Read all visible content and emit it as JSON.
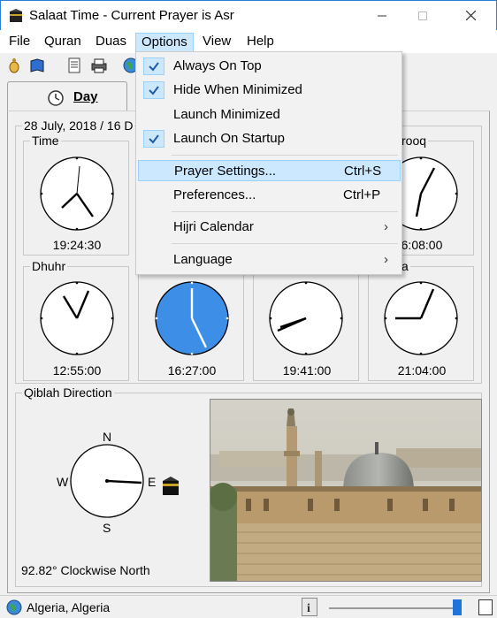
{
  "window": {
    "title": "Salaat Time - Current Prayer is Asr",
    "icon": "kaaba-icon"
  },
  "menubar": {
    "items": [
      "File",
      "Quran",
      "Duas",
      "Options",
      "View",
      "Help"
    ],
    "active": "Options"
  },
  "tabs": {
    "day_label": "Day"
  },
  "date_line": "28 July, 2018 / 16 D",
  "clocks": [
    {
      "label": "Time",
      "time": "19:24:30"
    },
    {
      "label": "rooq",
      "time": "6:08:00"
    },
    {
      "label": "Dhuhr",
      "time": "12:55:00"
    },
    {
      "label": "",
      "time": "16:27:00",
      "current": true
    },
    {
      "label": "",
      "time": "19:41:00"
    },
    {
      "label": "a",
      "time": "21:04:00"
    }
  ],
  "qiblah": {
    "title": "Qiblah Direction",
    "n": "N",
    "s": "S",
    "e": "E",
    "w": "W",
    "bearing": "92.82° Clockwise North"
  },
  "options_menu": {
    "always_on_top": {
      "label": "Always On Top",
      "checked": true
    },
    "hide_when_minimized": {
      "label": "Hide When Minimized",
      "checked": true
    },
    "launch_minimized": {
      "label": "Launch Minimized",
      "checked": false
    },
    "launch_on_startup": {
      "label": "Launch On Startup",
      "checked": true
    },
    "prayer_settings": {
      "label": "Prayer Settings...",
      "shortcut": "Ctrl+S"
    },
    "preferences": {
      "label": "Preferences...",
      "shortcut": "Ctrl+P"
    },
    "hijri_calendar": {
      "label": "Hijri Calendar"
    },
    "language": {
      "label": "Language"
    }
  },
  "status": {
    "location": "Algeria, Algeria"
  },
  "colors": {
    "accent": "#3d8ee6",
    "menu_highlight": "#cce8ff",
    "check_mark": "#1e5ba8",
    "window_border": "#2b7bd8"
  }
}
